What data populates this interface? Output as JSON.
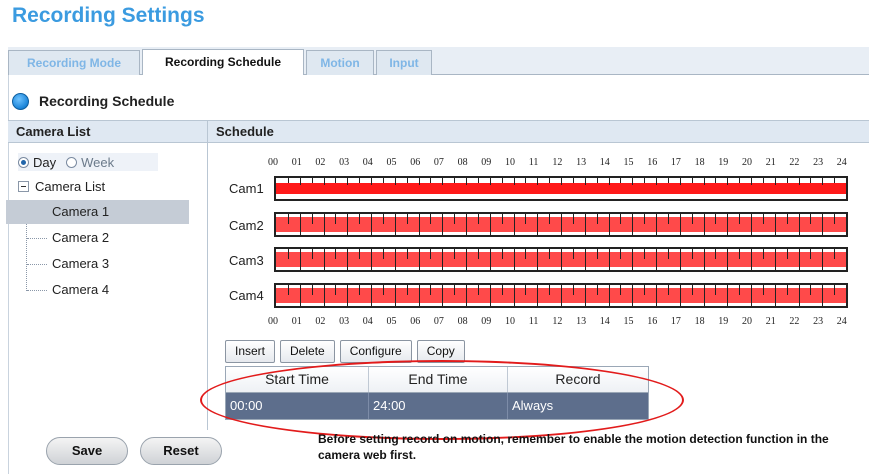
{
  "page_title": "Recording Settings",
  "tabs": [
    {
      "label": "Recording Mode",
      "active": false
    },
    {
      "label": "Recording Schedule",
      "active": true
    },
    {
      "label": "Motion",
      "active": false
    },
    {
      "label": "Input",
      "active": false
    }
  ],
  "section_title": "Recording Schedule",
  "camera_list": {
    "header": "Camera List",
    "view_options": [
      {
        "label": "Day",
        "checked": true
      },
      {
        "label": "Week",
        "checked": false
      }
    ],
    "root_label": "Camera List",
    "cameras": [
      "Camera 1",
      "Camera 2",
      "Camera 3",
      "Camera 4"
    ],
    "selected_index": 0
  },
  "schedule": {
    "header": "Schedule",
    "hours": [
      "00",
      "01",
      "02",
      "03",
      "04",
      "05",
      "06",
      "07",
      "08",
      "09",
      "10",
      "11",
      "12",
      "13",
      "14",
      "15",
      "16",
      "17",
      "18",
      "19",
      "20",
      "21",
      "22",
      "23",
      "24"
    ],
    "cams": [
      {
        "label": "Cam1",
        "record_from": 0,
        "record_to": 24,
        "color": "#ff1a1a"
      },
      {
        "label": "Cam2",
        "record_from": 0,
        "record_to": 24,
        "color": "#ff4a4a"
      },
      {
        "label": "Cam3",
        "record_from": 0,
        "record_to": 24,
        "color": "#ff4a4a"
      },
      {
        "label": "Cam4",
        "record_from": 0,
        "record_to": 24,
        "color": "#ff4a4a"
      }
    ],
    "buttons": {
      "insert": "Insert",
      "delete": "Delete",
      "configure": "Configure",
      "copy": "Copy"
    },
    "table": {
      "columns": [
        "Start Time",
        "End Time",
        "Record"
      ],
      "rows": [
        [
          "00:00",
          "24:00",
          "Always"
        ]
      ]
    }
  },
  "footer": {
    "save": "Save",
    "reset": "Reset",
    "note": "Before setting record on motion, remember to enable the motion detection function in the camera web first."
  },
  "colors": {
    "accent": "#3b9be0",
    "selected_row": "#5d6e8c",
    "highlight_ellipse": "#e21b1b"
  }
}
